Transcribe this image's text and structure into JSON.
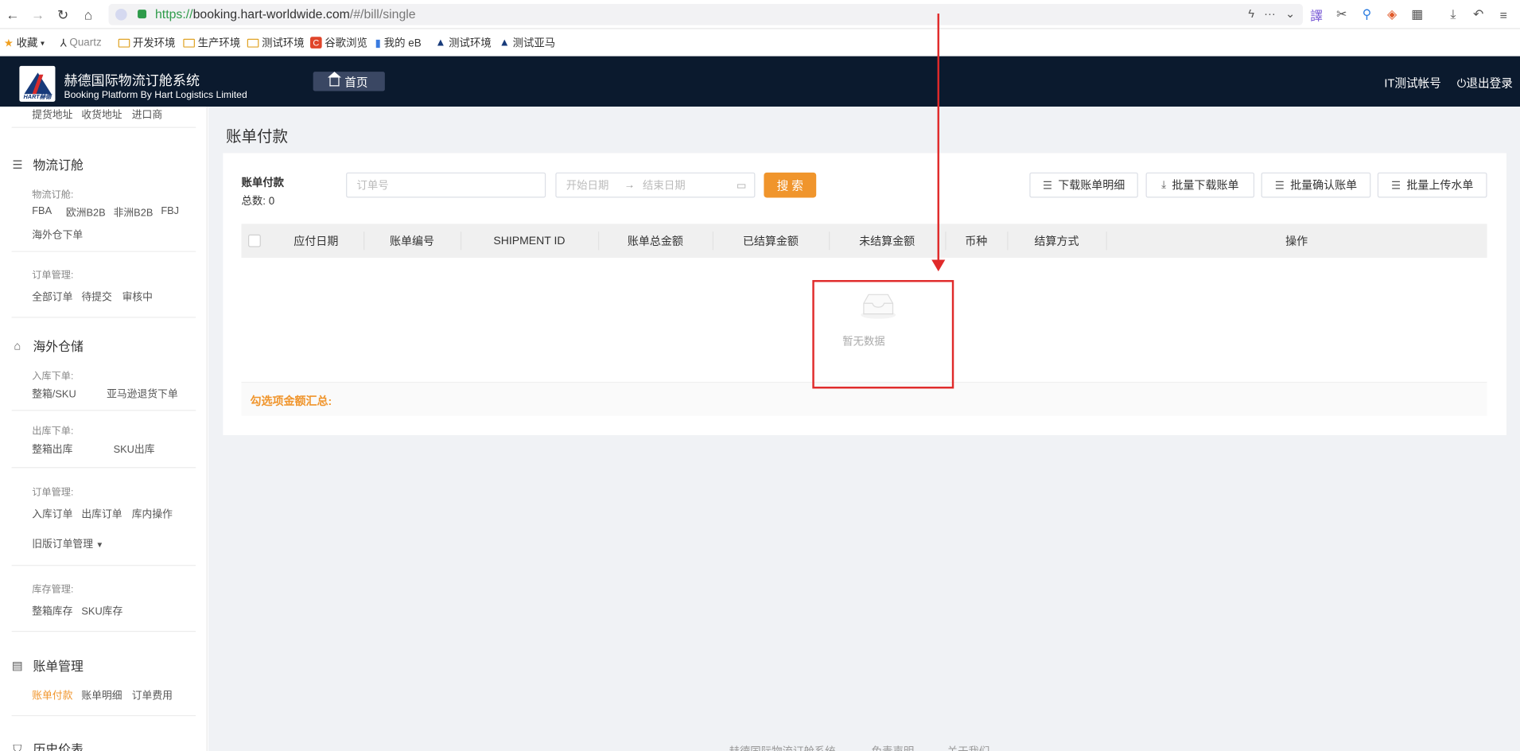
{
  "browser": {
    "url_proto": "https://",
    "url_host": "booking.hart-worldwide.com",
    "url_path": "/#/bill/single",
    "bookmarks": [
      "收藏",
      "Quartz",
      "开发环境",
      "生产环境",
      "测试环境",
      "谷歌浏览",
      "我的 eB",
      "测试环境",
      "测试亚马"
    ]
  },
  "header": {
    "logo_text": "HART赫德",
    "title": "赫德国际物流订舱系统",
    "subtitle": "Booking Platform By Hart Logistics Limited",
    "home_label": "首页",
    "account": "IT测试帐号",
    "logout": "退出登录"
  },
  "sidebar": {
    "top_links": [
      "提货地址",
      "收货地址",
      "进口商"
    ],
    "logistics": {
      "title": "物流订舱",
      "booking_label": "物流订舱:",
      "booking_items": [
        "FBA",
        "欧洲B2B",
        "非洲B2B",
        "FBJ"
      ],
      "overseas_item": "海外仓下单",
      "order_label": "订单管理:",
      "order_items": [
        "全部订单",
        "待提交",
        "审核中"
      ]
    },
    "warehouse": {
      "title": "海外仓储",
      "inbound_label": "入库下单:",
      "inbound_items": [
        "整箱/SKU",
        "亚马逊退货下单"
      ],
      "outbound_label": "出库下单:",
      "outbound_items": [
        "整箱出库",
        "SKU出库"
      ],
      "order_label": "订单管理:",
      "order_items": [
        "入库订单",
        "出库订单",
        "库内操作"
      ],
      "legacy": "旧版订单管理",
      "stock_label": "库存管理:",
      "stock_items": [
        "整箱库存",
        "SKU库存"
      ]
    },
    "billing": {
      "title": "账单管理",
      "items": [
        "账单付款",
        "账单明细",
        "订单费用"
      ]
    },
    "history": {
      "title": "历史价表"
    }
  },
  "main": {
    "page_title": "账单付款",
    "card_title": "账单付款",
    "count_label": "总数:  0",
    "order_placeholder": "订单号",
    "start_placeholder": "开始日期",
    "end_placeholder": "结束日期",
    "search_label": "搜 索",
    "actions": [
      "下载账单明细",
      "批量下载账单",
      "批量确认账单",
      "批量上传水单"
    ],
    "columns": [
      "应付日期",
      "账单编号",
      "SHIPMENT ID",
      "账单总金额",
      "已结算金额",
      "未结算金额",
      "币种",
      "结算方式",
      "操作"
    ],
    "empty_text": "暂无数据",
    "summary_label": "勾选项金额汇总:"
  },
  "footer": {
    "links": [
      "赫德国际物流订舱系统",
      "免责声明",
      "关于我们"
    ]
  },
  "colors": {
    "accent": "#f0952c",
    "header_bg": "#0b1a2e",
    "annotation": "#e02a2a"
  }
}
